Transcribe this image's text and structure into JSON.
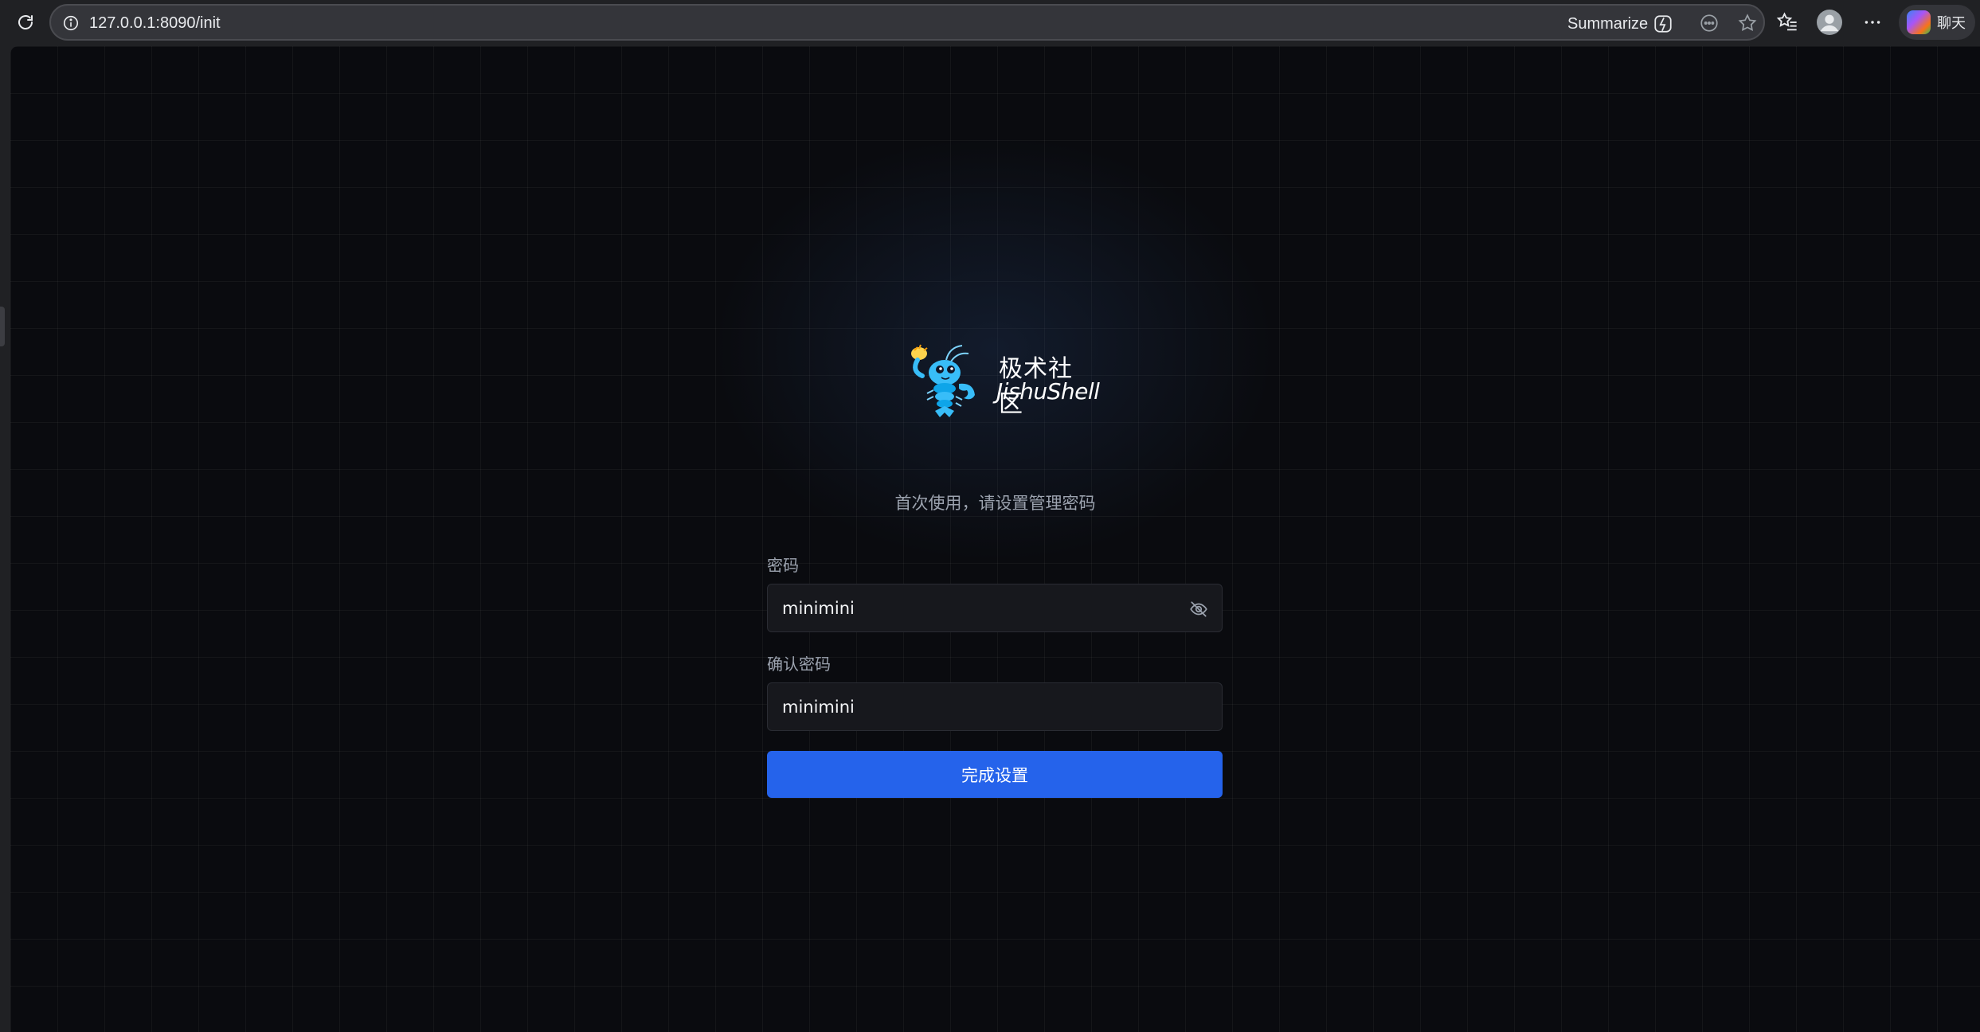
{
  "browser": {
    "url": "127.0.0.1:8090/init",
    "summarize_label": "Summarize",
    "copilot_label": "聊天",
    "icons": [
      "reload-icon",
      "info-icon",
      "summarize-icon",
      "reading-mode-icon",
      "favorite-star-icon",
      "favorites-icon",
      "profile-avatar-icon",
      "more-icon",
      "copilot-icon"
    ]
  },
  "brand": {
    "name_cn": "极术社区",
    "name_en": "JishuShell",
    "logo_icon": "lobster-mascot-icon"
  },
  "setup": {
    "subtitle": "首次使用，请设置管理密码",
    "password_label": "密码",
    "password_value": "minimini",
    "confirm_label": "确认密码",
    "confirm_value": "minimini",
    "visibility_icon": "eye-off-icon",
    "submit_label": "完成设置"
  },
  "colors": {
    "background": "#0a0b0f",
    "accent": "#2563eb",
    "input_bg": "#17181d",
    "muted_text": "#9ca3af"
  }
}
